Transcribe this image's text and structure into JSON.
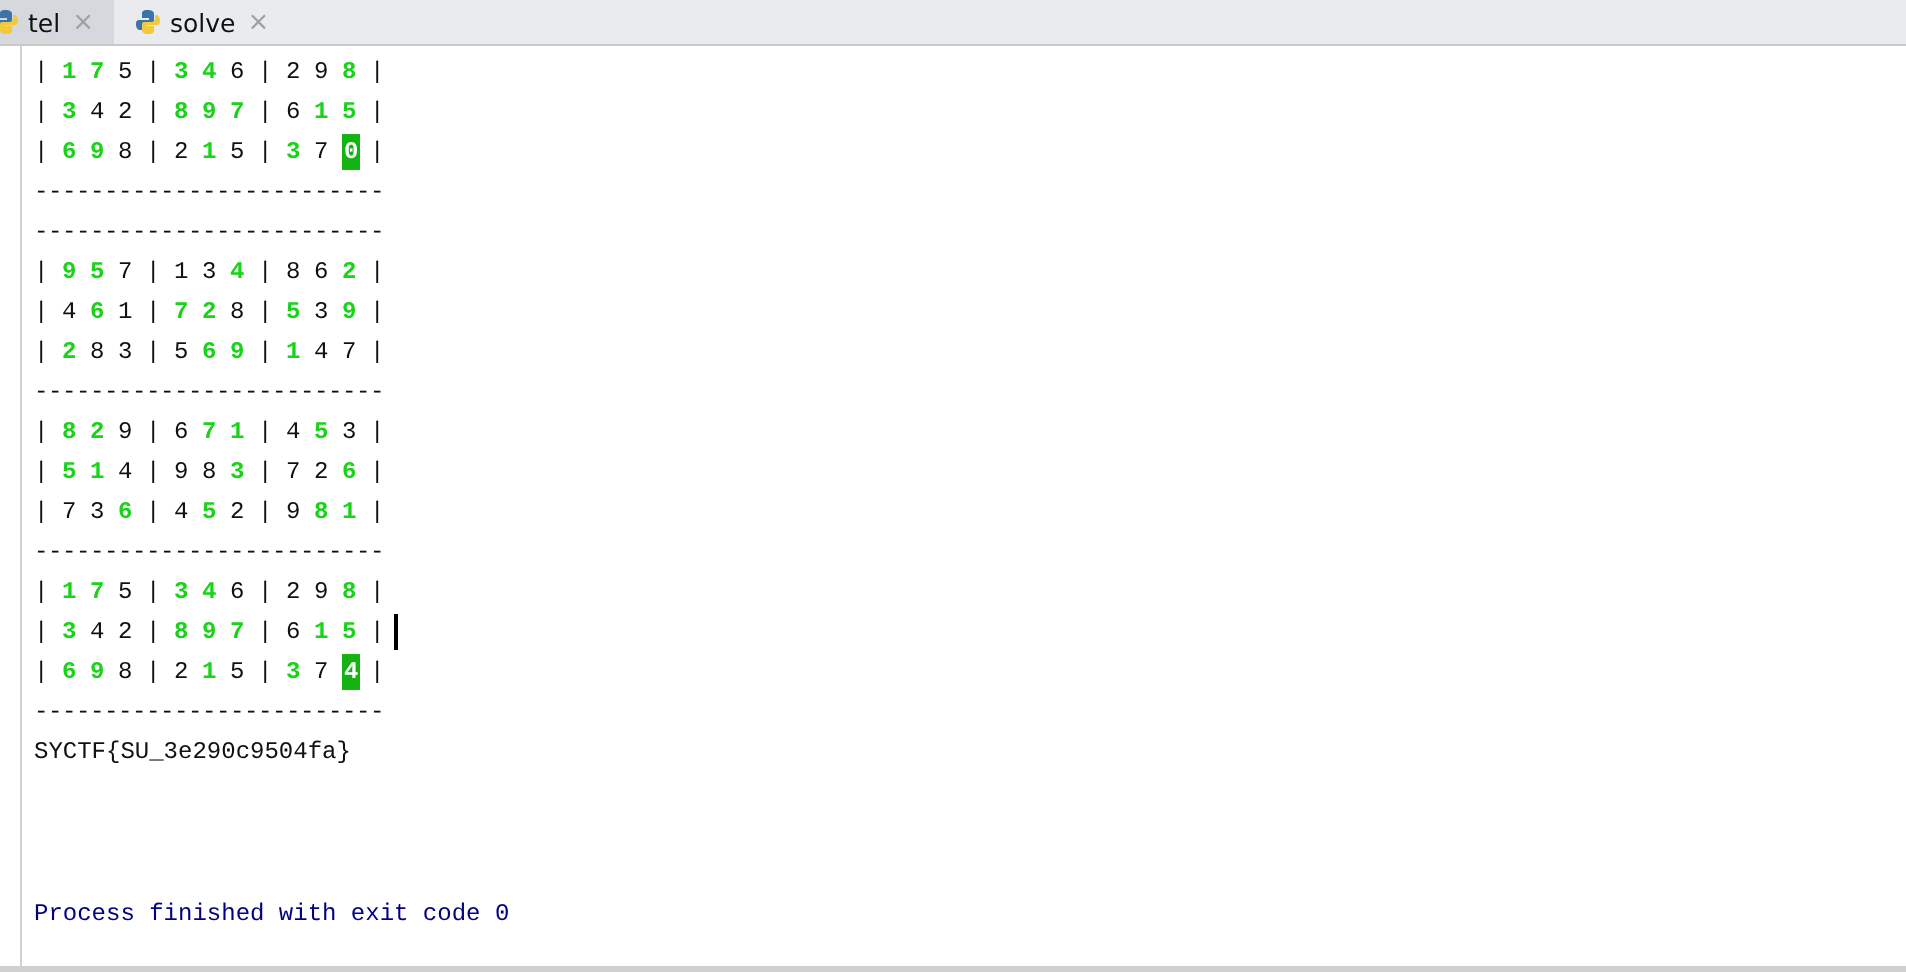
{
  "tabs": [
    {
      "label": "tel",
      "close": "×",
      "selected": true
    },
    {
      "label": "solve",
      "close": "×",
      "selected": false
    }
  ],
  "console": {
    "separator": "|",
    "lines": [
      {
        "kind": "row",
        "caret": false,
        "cells": [
          {
            "d": "1",
            "green": true
          },
          {
            "d": "7",
            "green": true
          },
          {
            "d": "5",
            "green": false
          },
          {
            "d": "3",
            "green": true
          },
          {
            "d": "4",
            "green": true
          },
          {
            "d": "6",
            "green": false
          },
          {
            "d": "2",
            "green": false
          },
          {
            "d": "9",
            "green": false
          },
          {
            "d": "8",
            "green": true
          }
        ]
      },
      {
        "kind": "row",
        "caret": false,
        "cells": [
          {
            "d": "3",
            "green": true
          },
          {
            "d": "4",
            "green": false
          },
          {
            "d": "2",
            "green": false
          },
          {
            "d": "8",
            "green": true
          },
          {
            "d": "9",
            "green": true
          },
          {
            "d": "7",
            "green": true
          },
          {
            "d": "6",
            "green": false
          },
          {
            "d": "1",
            "green": true
          },
          {
            "d": "5",
            "green": true
          }
        ]
      },
      {
        "kind": "row",
        "caret": false,
        "cells": [
          {
            "d": "6",
            "green": true
          },
          {
            "d": "9",
            "green": true
          },
          {
            "d": "8",
            "green": false
          },
          {
            "d": "2",
            "green": false
          },
          {
            "d": "1",
            "green": true
          },
          {
            "d": "5",
            "green": false
          },
          {
            "d": "3",
            "green": true
          },
          {
            "d": "7",
            "green": false
          },
          {
            "d": "0",
            "green": true,
            "highlighted": true
          }
        ]
      },
      {
        "kind": "rule",
        "text": "-------------------------"
      },
      {
        "kind": "rule",
        "text": "-------------------------"
      },
      {
        "kind": "row",
        "caret": false,
        "cells": [
          {
            "d": "9",
            "green": true
          },
          {
            "d": "5",
            "green": true
          },
          {
            "d": "7",
            "green": false
          },
          {
            "d": "1",
            "green": false
          },
          {
            "d": "3",
            "green": false
          },
          {
            "d": "4",
            "green": true
          },
          {
            "d": "8",
            "green": false
          },
          {
            "d": "6",
            "green": false
          },
          {
            "d": "2",
            "green": true
          }
        ]
      },
      {
        "kind": "row",
        "caret": false,
        "cells": [
          {
            "d": "4",
            "green": false
          },
          {
            "d": "6",
            "green": true
          },
          {
            "d": "1",
            "green": false
          },
          {
            "d": "7",
            "green": true
          },
          {
            "d": "2",
            "green": true
          },
          {
            "d": "8",
            "green": false
          },
          {
            "d": "5",
            "green": true
          },
          {
            "d": "3",
            "green": false
          },
          {
            "d": "9",
            "green": true
          }
        ]
      },
      {
        "kind": "row",
        "caret": false,
        "cells": [
          {
            "d": "2",
            "green": true
          },
          {
            "d": "8",
            "green": false
          },
          {
            "d": "3",
            "green": false
          },
          {
            "d": "5",
            "green": false
          },
          {
            "d": "6",
            "green": true
          },
          {
            "d": "9",
            "green": true
          },
          {
            "d": "1",
            "green": true
          },
          {
            "d": "4",
            "green": false
          },
          {
            "d": "7",
            "green": false
          }
        ]
      },
      {
        "kind": "rule",
        "text": "-------------------------"
      },
      {
        "kind": "row",
        "caret": false,
        "cells": [
          {
            "d": "8",
            "green": true
          },
          {
            "d": "2",
            "green": true
          },
          {
            "d": "9",
            "green": false
          },
          {
            "d": "6",
            "green": false
          },
          {
            "d": "7",
            "green": true
          },
          {
            "d": "1",
            "green": true
          },
          {
            "d": "4",
            "green": false
          },
          {
            "d": "5",
            "green": true
          },
          {
            "d": "3",
            "green": false
          }
        ]
      },
      {
        "kind": "row",
        "caret": false,
        "cells": [
          {
            "d": "5",
            "green": true
          },
          {
            "d": "1",
            "green": true
          },
          {
            "d": "4",
            "green": false
          },
          {
            "d": "9",
            "green": false
          },
          {
            "d": "8",
            "green": false
          },
          {
            "d": "3",
            "green": true
          },
          {
            "d": "7",
            "green": false
          },
          {
            "d": "2",
            "green": false
          },
          {
            "d": "6",
            "green": true
          }
        ]
      },
      {
        "kind": "row",
        "caret": false,
        "cells": [
          {
            "d": "7",
            "green": false
          },
          {
            "d": "3",
            "green": false
          },
          {
            "d": "6",
            "green": true
          },
          {
            "d": "4",
            "green": false
          },
          {
            "d": "5",
            "green": true
          },
          {
            "d": "2",
            "green": false
          },
          {
            "d": "9",
            "green": false
          },
          {
            "d": "8",
            "green": true
          },
          {
            "d": "1",
            "green": true
          }
        ]
      },
      {
        "kind": "rule",
        "text": "-------------------------"
      },
      {
        "kind": "row",
        "caret": false,
        "cells": [
          {
            "d": "1",
            "green": true
          },
          {
            "d": "7",
            "green": true
          },
          {
            "d": "5",
            "green": false
          },
          {
            "d": "3",
            "green": true
          },
          {
            "d": "4",
            "green": true
          },
          {
            "d": "6",
            "green": false
          },
          {
            "d": "2",
            "green": false
          },
          {
            "d": "9",
            "green": false
          },
          {
            "d": "8",
            "green": true
          }
        ]
      },
      {
        "kind": "row",
        "caret": true,
        "cells": [
          {
            "d": "3",
            "green": true
          },
          {
            "d": "4",
            "green": false
          },
          {
            "d": "2",
            "green": false
          },
          {
            "d": "8",
            "green": true
          },
          {
            "d": "9",
            "green": true
          },
          {
            "d": "7",
            "green": true
          },
          {
            "d": "6",
            "green": false
          },
          {
            "d": "1",
            "green": true
          },
          {
            "d": "5",
            "green": true
          }
        ]
      },
      {
        "kind": "row",
        "caret": false,
        "cells": [
          {
            "d": "6",
            "green": true
          },
          {
            "d": "9",
            "green": true
          },
          {
            "d": "8",
            "green": false
          },
          {
            "d": "2",
            "green": false
          },
          {
            "d": "1",
            "green": true
          },
          {
            "d": "5",
            "green": false
          },
          {
            "d": "3",
            "green": true
          },
          {
            "d": "7",
            "green": false
          },
          {
            "d": "4",
            "green": true,
            "highlighted": true
          }
        ]
      },
      {
        "kind": "rule",
        "text": "-------------------------"
      },
      {
        "kind": "text",
        "text": "SYCTF{SU_3e290c9504fa}"
      },
      {
        "kind": "exit",
        "text": "Process finished with exit code 0"
      }
    ]
  }
}
